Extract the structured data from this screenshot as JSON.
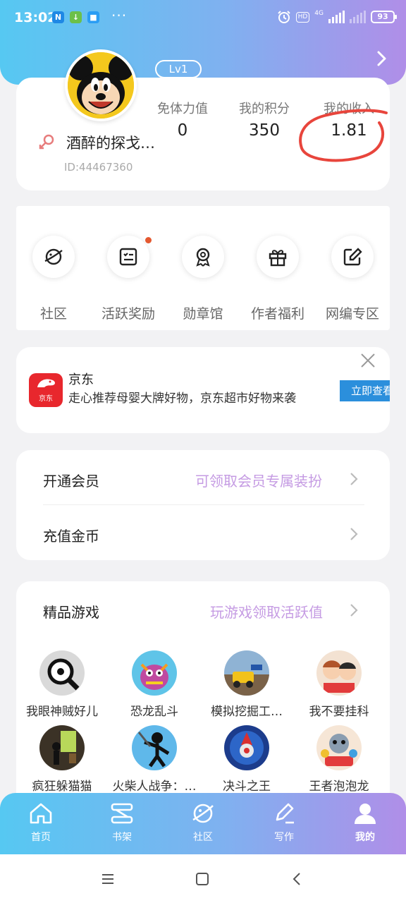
{
  "status_bar": {
    "time": "13:02",
    "app_badges": [
      "N",
      "↓",
      "■"
    ],
    "more": "···",
    "hd": "HD",
    "network": "4G",
    "battery": "93"
  },
  "profile": {
    "level": "Lv1",
    "nickname": "酒醉的探戈…",
    "user_id": "ID:44467360",
    "stats": [
      {
        "label": "免体力值",
        "value": "0"
      },
      {
        "label": "我的积分",
        "value": "350"
      },
      {
        "label": "我的收入",
        "value": "1.81"
      }
    ]
  },
  "shortcuts": [
    {
      "label": "社区",
      "icon": "planet-icon"
    },
    {
      "label": "活跃奖励",
      "icon": "checklist-icon",
      "has_dot": true
    },
    {
      "label": "勋章馆",
      "icon": "medal-icon"
    },
    {
      "label": "作者福利",
      "icon": "gift-icon"
    },
    {
      "label": "网编专区",
      "icon": "edit-icon"
    }
  ],
  "ad": {
    "logo_text": "京东",
    "title": "京东",
    "description": "走心推荐母婴大牌好物，京东超市好物来袭",
    "button": "立即查看"
  },
  "member": {
    "open_vip_label": "开通会员",
    "open_vip_hint": "可领取会员专属装扮",
    "recharge_label": "充值金币"
  },
  "games": {
    "title": "精品游戏",
    "hint": "玩游戏领取活跃值",
    "items": [
      {
        "name": "我眼神贼好儿"
      },
      {
        "name": "恐龙乱斗"
      },
      {
        "name": "模拟挖掘工…"
      },
      {
        "name": "我不要挂科"
      },
      {
        "name": "疯狂躲猫猫"
      },
      {
        "name": "火柴人战争：…"
      },
      {
        "name": "决斗之王"
      },
      {
        "name": "王者泡泡龙"
      }
    ]
  },
  "bottom_nav": [
    {
      "label": "首页",
      "icon": "home-icon"
    },
    {
      "label": "书架",
      "icon": "bookshelf-icon"
    },
    {
      "label": "社区",
      "icon": "planet-icon"
    },
    {
      "label": "写作",
      "icon": "pen-icon"
    },
    {
      "label": "我的",
      "icon": "user-icon",
      "active": true
    }
  ],
  "colors": {
    "gradient_start": "#56c8f2",
    "gradient_end": "#b08ee8",
    "hint_purple": "#c59be3",
    "annotation_red": "#e8453c",
    "ad_button_blue": "#2b8fdc"
  }
}
